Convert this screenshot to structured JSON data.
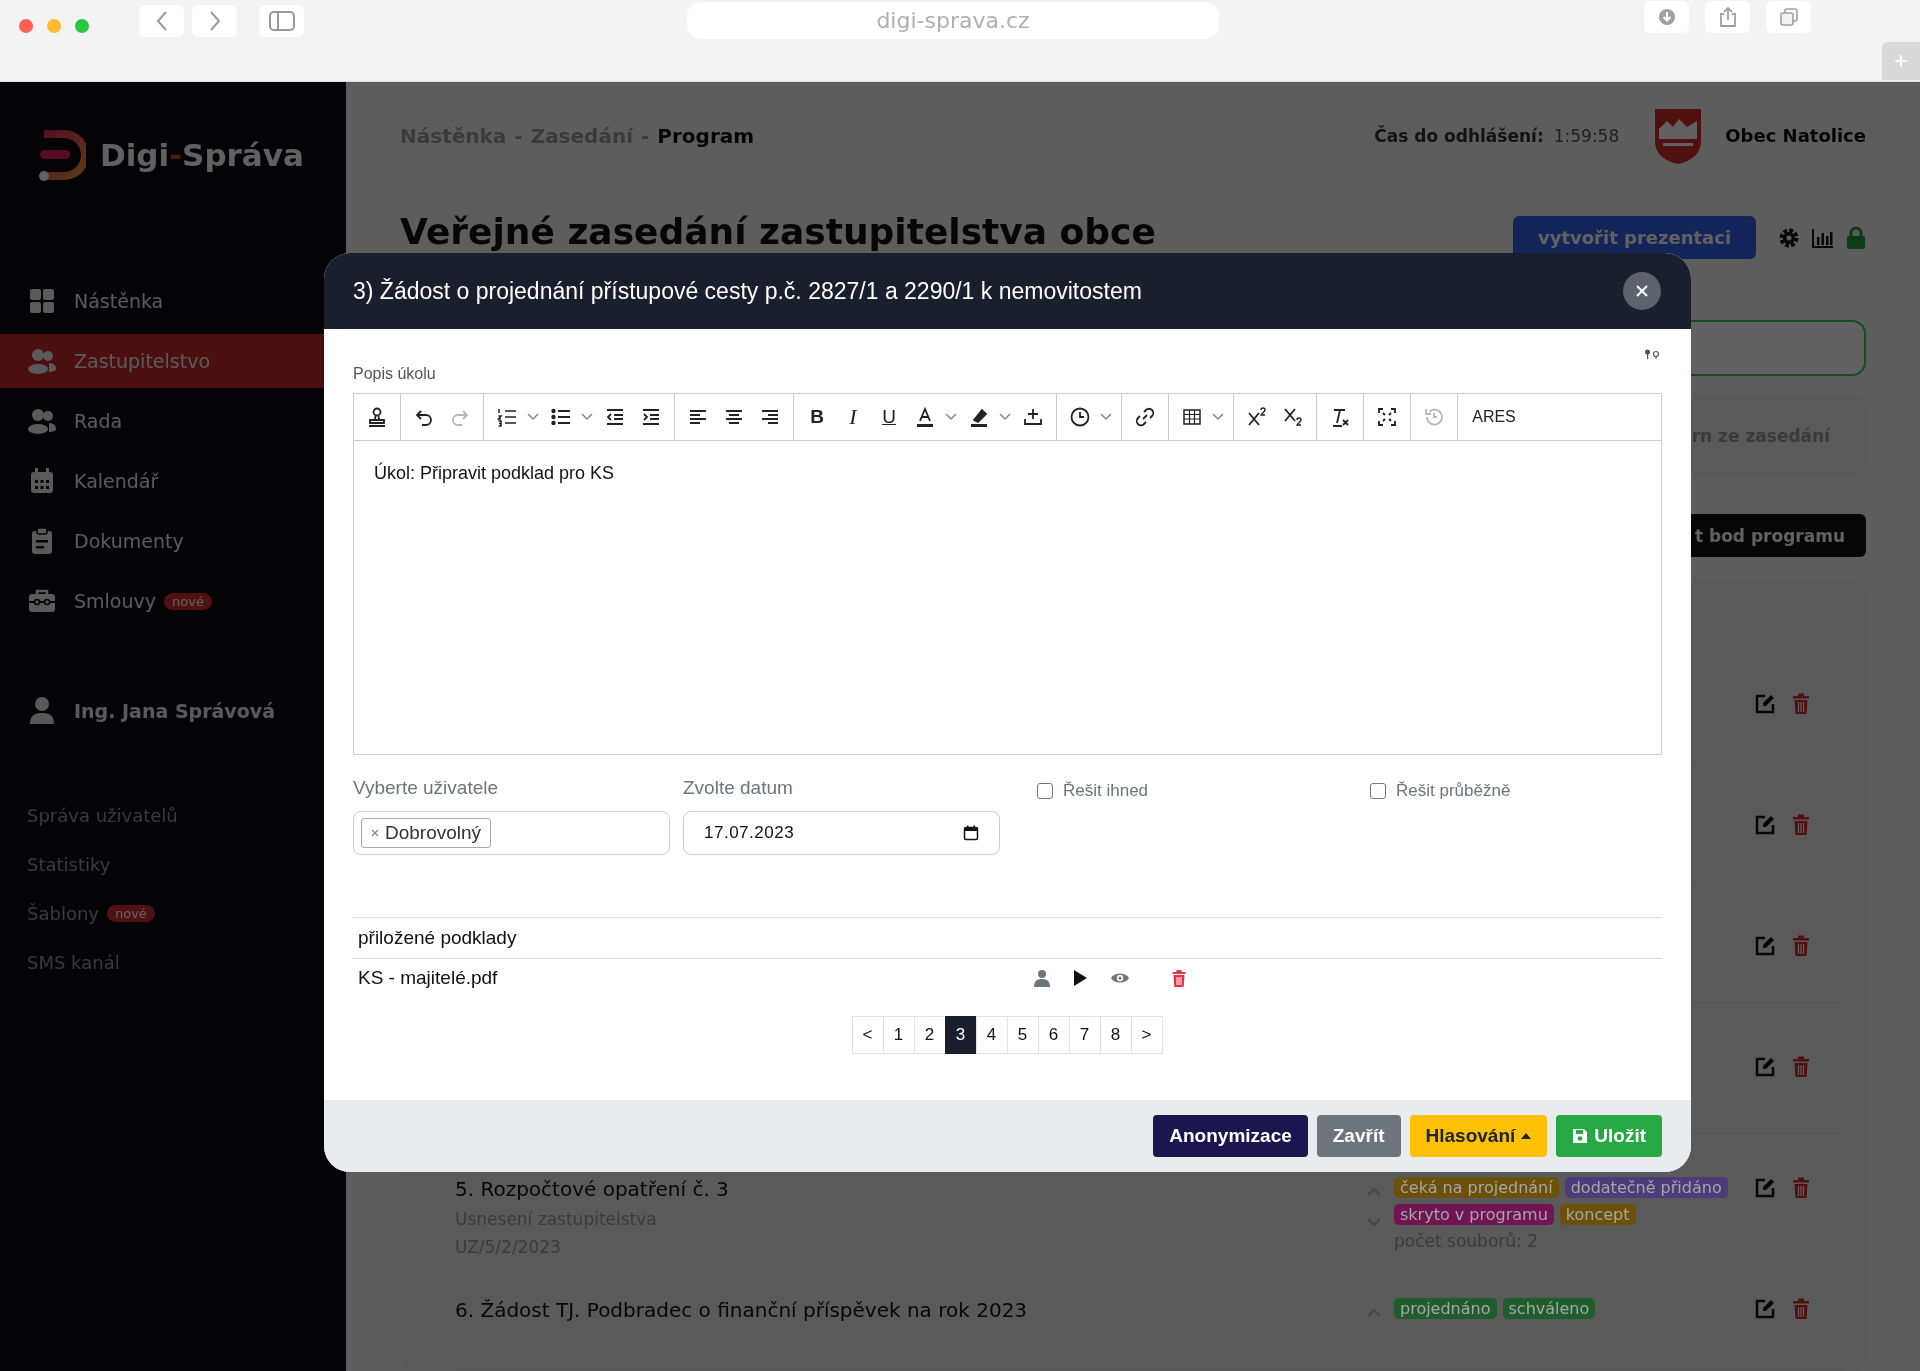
{
  "browser": {
    "url": "digi-sprava.cz"
  },
  "sidebar": {
    "logo": [
      {
        "text": "Digi",
        "accent": false
      },
      {
        "text": "-",
        "accent": true
      },
      {
        "text": "Správa",
        "accent": false
      }
    ],
    "nav": [
      {
        "label": "Nástěnka",
        "kind": "grid",
        "selected": false
      },
      {
        "label": "Zastupitelstvo",
        "kind": "people",
        "selected": true
      },
      {
        "label": "Rada",
        "kind": "people",
        "selected": false
      },
      {
        "label": "Kalendář",
        "kind": "calendar",
        "selected": false
      },
      {
        "label": "Dokumenty",
        "kind": "clipboard",
        "selected": false
      },
      {
        "label": "Smlouvy",
        "kind": "briefcase",
        "selected": false,
        "badge": "nové"
      }
    ],
    "user": "Ing. Jana Správová",
    "admin_links": [
      {
        "label": "Správa uživatelů"
      },
      {
        "label": "Statistiky"
      },
      {
        "label": "Šablony",
        "badge": "nové"
      },
      {
        "label": "SMS kanál"
      }
    ]
  },
  "header": {
    "breadcrumb": [
      {
        "label": "Nástěnka",
        "current": false
      },
      {
        "label": "Zasedání",
        "current": false
      },
      {
        "label": "Program",
        "current": true
      }
    ],
    "separator": "-",
    "logout_label": "Čas do odhlášení:",
    "logout_time": "1:59:58",
    "municipality": "Obec Natolice"
  },
  "page": {
    "title": "Veřejné zasedání zastupitelstva obce",
    "presentation_button": "vytvořit prezentaci",
    "download_fragment": "rn ze zasedání",
    "add_fragment": "t bod programu"
  },
  "program_items": [
    {
      "kind": "covered"
    },
    {
      "kind": "covered"
    },
    {
      "kind": "covered"
    },
    {
      "kind": "covered"
    },
    {
      "kind": "item",
      "title": "5. Rozpočtové opatření č. 3",
      "subtitle": "Usnesení zastupitelstva",
      "code": "UZ/5/2/2023",
      "tags": [
        {
          "label": "čeká na projednání",
          "color": "#6b5108"
        },
        {
          "label": "dodatečně přidáno",
          "color": "#4e3b7a"
        },
        {
          "label": "skryto v programu",
          "color": "#701553"
        },
        {
          "label": "koncept",
          "color": "#6b5108"
        }
      ],
      "files": "počet souborů: 2"
    },
    {
      "kind": "item",
      "title": "6. Žádost TJ. Podbradec o finanční příspěvek na rok 2023",
      "tags": [
        {
          "label": "projednáno",
          "color": "#1f5e2c"
        },
        {
          "label": "schváleno",
          "color": "#1f5e2c"
        }
      ]
    }
  ],
  "modal": {
    "title": "3) Žádost o projednání přístupové cesty p.č. 2827/1 a 2290/1 k nemovitostem",
    "description_label": "Popis úkolu",
    "toolbar": [
      [
        {
          "kind": "stamp",
          "disabled": false
        }
      ],
      [
        {
          "kind": "undo",
          "disabled": false
        },
        {
          "kind": "redo",
          "disabled": true
        }
      ],
      [
        {
          "kind": "ordered-list",
          "disabled": false
        },
        {
          "kind": "caret",
          "disabled": false
        },
        {
          "kind": "bullet-list",
          "disabled": false
        },
        {
          "kind": "caret",
          "disabled": false
        },
        {
          "kind": "outdent",
          "disabled": false
        },
        {
          "kind": "indent",
          "disabled": false
        }
      ],
      [
        {
          "kind": "align-left",
          "disabled": false
        },
        {
          "kind": "align-center",
          "disabled": false
        },
        {
          "kind": "align-right",
          "disabled": false
        }
      ],
      [
        {
          "kind": "bold",
          "label": "B",
          "disabled": false
        },
        {
          "kind": "italic",
          "label": "I",
          "disabled": false
        },
        {
          "kind": "underline",
          "label": "U",
          "disabled": false
        },
        {
          "kind": "text-color",
          "disabled": false
        },
        {
          "kind": "caret",
          "disabled": false
        },
        {
          "kind": "highlight",
          "disabled": false
        },
        {
          "kind": "caret",
          "disabled": false
        },
        {
          "kind": "insert",
          "disabled": false
        }
      ],
      [
        {
          "kind": "clock",
          "disabled": false
        },
        {
          "kind": "caret",
          "disabled": false
        }
      ],
      [
        {
          "kind": "link",
          "disabled": false
        }
      ],
      [
        {
          "kind": "table",
          "disabled": false
        },
        {
          "kind": "caret",
          "disabled": false
        }
      ],
      [
        {
          "kind": "superscript",
          "disabled": false
        },
        {
          "kind": "subscript",
          "disabled": false
        }
      ],
      [
        {
          "kind": "clear-format",
          "disabled": false
        }
      ],
      [
        {
          "kind": "fullscreen",
          "disabled": false
        }
      ],
      [
        {
          "kind": "history",
          "disabled": true
        }
      ],
      [
        {
          "kind": "text",
          "label": "ARES",
          "disabled": false
        }
      ]
    ],
    "content": "Úkol: Připravit podklad pro KS",
    "user_label": "Vyberte uživatele",
    "users": [
      "Dobrovolný"
    ],
    "date_label": "Zvolte datum",
    "date": "17.07.2023",
    "checkboxes": [
      {
        "label": "Řešit ihned",
        "checked": false
      },
      {
        "label": "Řešit průběžně",
        "checked": false
      }
    ],
    "attachments_heading": "přiložené podklady",
    "attachments": [
      {
        "name": "KS - majitelé.pdf"
      }
    ],
    "pages": [
      {
        "label": "<",
        "selected": false
      },
      {
        "label": "1",
        "selected": false
      },
      {
        "label": "2",
        "selected": false
      },
      {
        "label": "3",
        "selected": true
      },
      {
        "label": "4",
        "selected": false
      },
      {
        "label": "5",
        "selected": false
      },
      {
        "label": "6",
        "selected": false
      },
      {
        "label": "7",
        "selected": false
      },
      {
        "label": "8",
        "selected": false
      },
      {
        "label": ">",
        "selected": false
      }
    ],
    "buttons": [
      {
        "label": "Anonymizace",
        "kind": "dark"
      },
      {
        "label": "Zavřít",
        "kind": "secondary"
      },
      {
        "label": "Hlasování",
        "kind": "warning"
      },
      {
        "label": "Uložit",
        "kind": "success"
      }
    ]
  }
}
